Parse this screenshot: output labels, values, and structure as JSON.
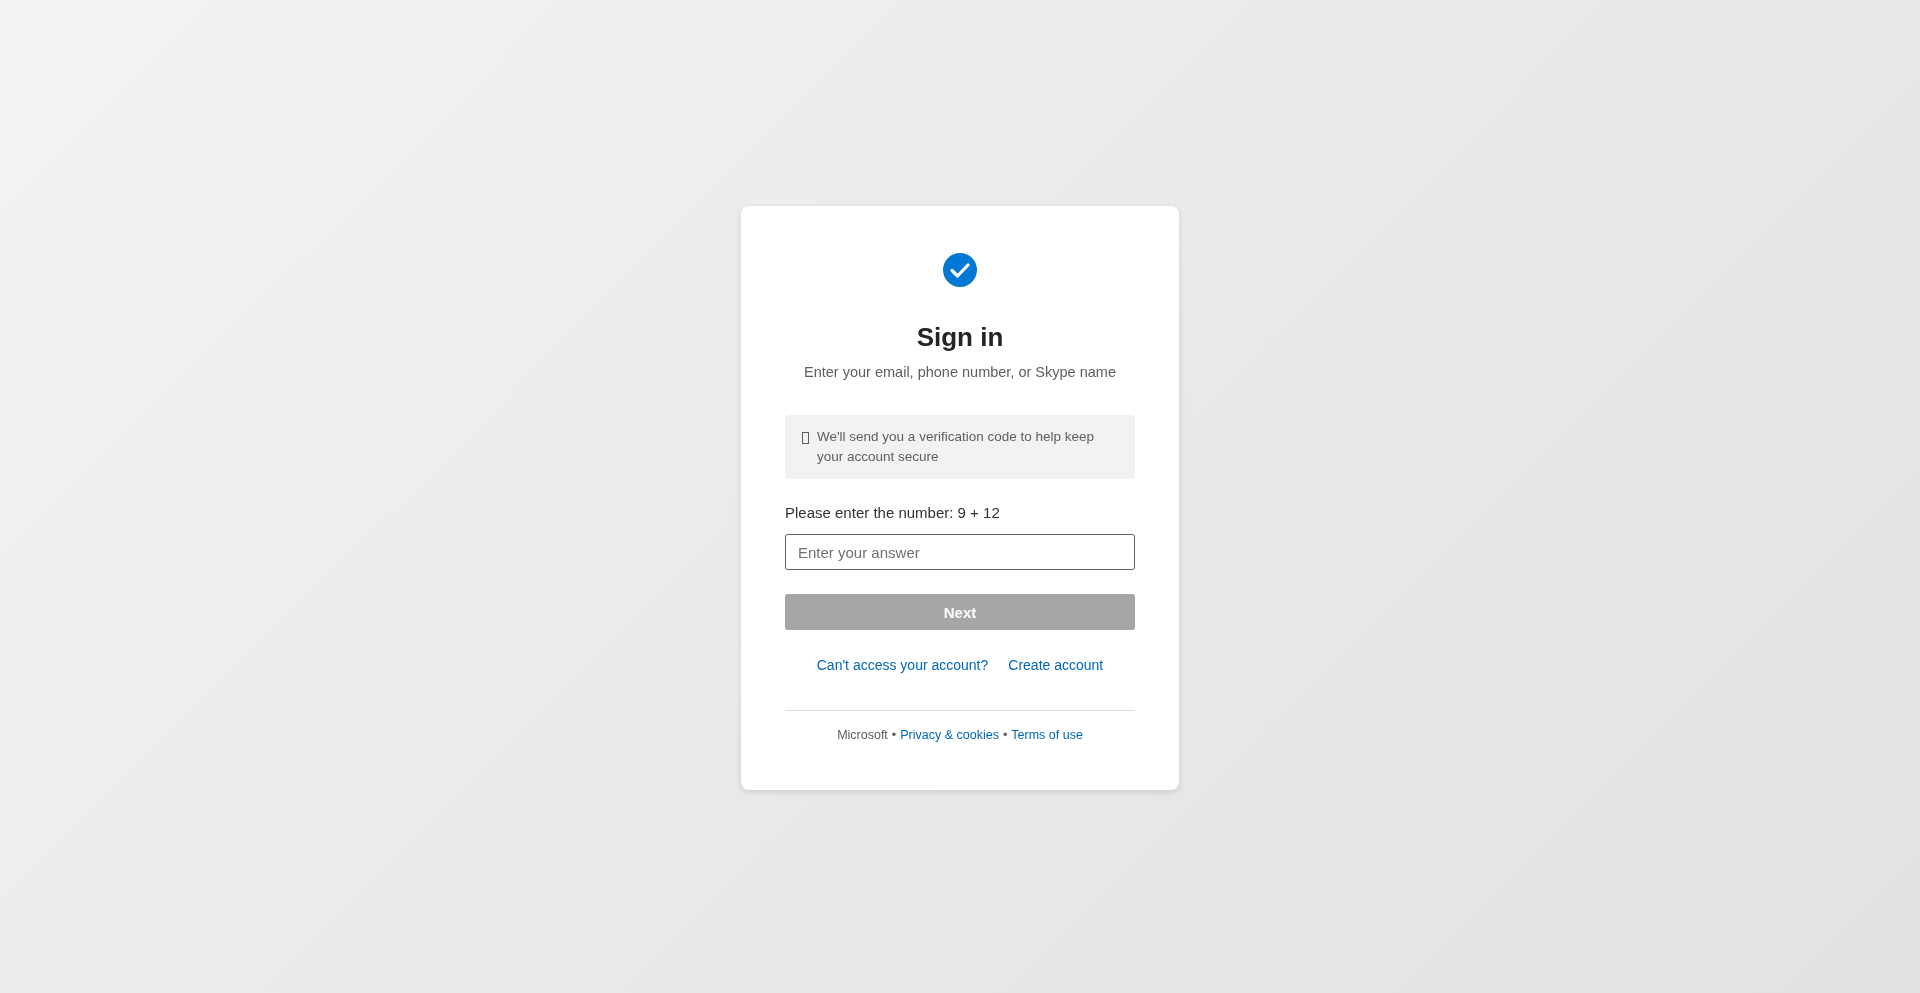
{
  "card": {
    "title": "Sign in",
    "subtitle": "Enter your email, phone number, or Skype name",
    "notice": {
      "text": "We'll send you a verification code to help keep your account secure"
    },
    "question": {
      "label": "Please enter the number: 9 + 12",
      "placeholder": "Enter your answer"
    },
    "next_button": {
      "label": "Next",
      "disabled": true
    },
    "links": [
      "Can't access your account?",
      "Create account"
    ],
    "footer": [
      {
        "kind": "text",
        "text": "Microsoft"
      },
      {
        "kind": "text",
        "text": "•"
      },
      {
        "kind": "link",
        "text": "Privacy & cookies"
      },
      {
        "kind": "text",
        "text": "•"
      },
      {
        "kind": "link",
        "text": "Terms of use"
      }
    ]
  }
}
